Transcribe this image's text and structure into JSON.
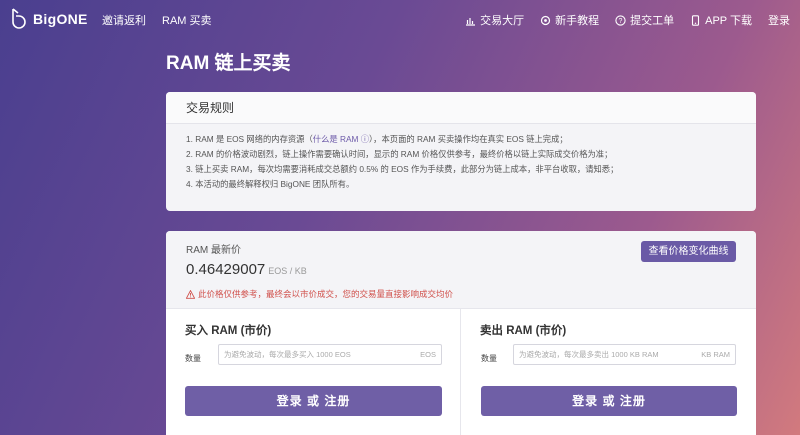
{
  "brand": {
    "name": "BigONE",
    "accent": "#6a5aa6"
  },
  "nav": {
    "left": [
      {
        "label": "邀请返利"
      },
      {
        "label": "RAM 买卖"
      }
    ],
    "right": [
      {
        "label": "交易大厅",
        "icon": "chart-bar-icon"
      },
      {
        "label": "新手教程",
        "icon": "gear-icon"
      },
      {
        "label": "提交工单",
        "icon": "help-circle-icon"
      },
      {
        "label": "APP 下载",
        "icon": "phone-icon"
      },
      {
        "label": "登录"
      }
    ]
  },
  "page": {
    "title": "RAM 链上买卖"
  },
  "rules": {
    "heading": "交易规则",
    "items": [
      {
        "pre": "1. RAM 是 EOS 网络的内存资源（",
        "link": "什么是 RAM ⓘ",
        "post": "），本页面的 RAM 买卖操作均在真实 EOS 链上完成；"
      },
      {
        "pre": "2. RAM 的价格波动剧烈，链上操作需要确认时间，显示的 RAM 价格仅供参考，最终价格以链上实际成交价格为准；",
        "link": "",
        "post": ""
      },
      {
        "pre": "3. 链上买卖 RAM，每次均需要消耗成交总额约 0.5% 的 EOS 作为手续费，此部分为链上成本，非平台收取，请知悉；",
        "link": "",
        "post": ""
      },
      {
        "pre": "4. 本活动的最终解释权归 BigONE 团队所有。",
        "link": "",
        "post": ""
      }
    ]
  },
  "price": {
    "label": "RAM 最新价",
    "value": "0.46429007",
    "unit": "EOS / KB",
    "warning": "此价格仅供参考，最终会以市价成交，您的交易量直接影响成交均价",
    "chart_button": "查看价格变化曲线"
  },
  "buy": {
    "title": "买入 RAM (市价)",
    "qty_label": "数量",
    "placeholder": "为避免波动，每次最多买入 1000 EOS",
    "unit": "EOS",
    "button": "登录 或 注册"
  },
  "sell": {
    "title": "卖出 RAM (市价)",
    "qty_label": "数量",
    "placeholder": "为避免波动，每次最多卖出 1000 KB RAM",
    "unit": "KB RAM",
    "button": "登录 或 注册"
  }
}
